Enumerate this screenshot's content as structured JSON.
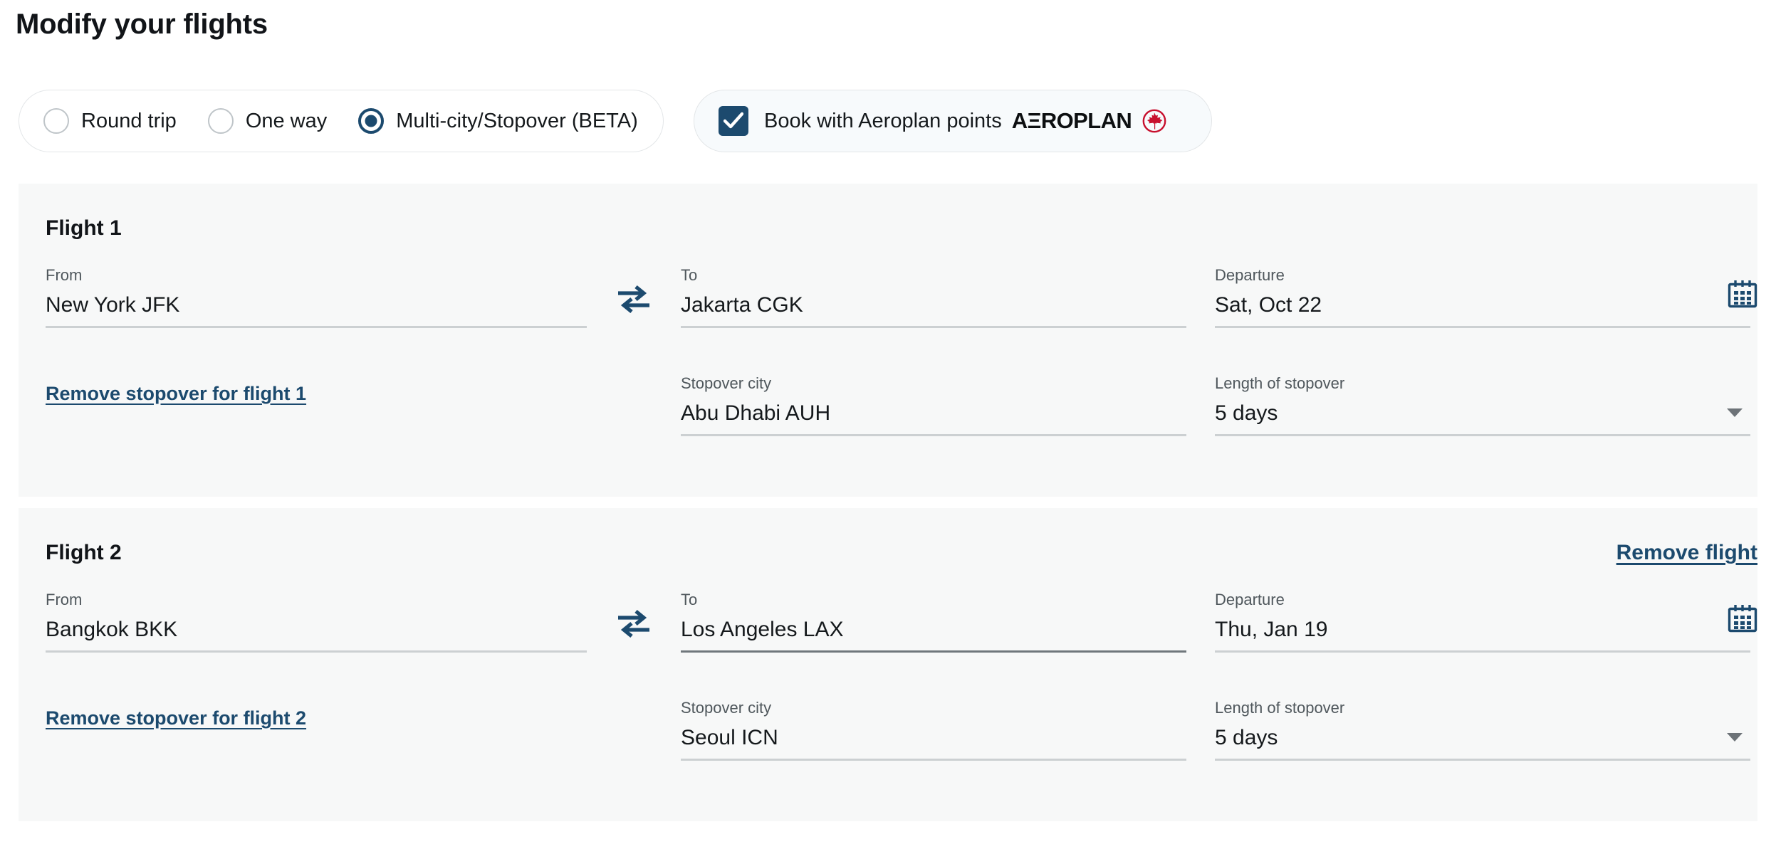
{
  "page_title": "Modify your flights",
  "trip_type": {
    "options": [
      {
        "label": "Round trip",
        "selected": false
      },
      {
        "label": "One way",
        "selected": false
      },
      {
        "label": "Multi-city/Stopover (BETA)",
        "selected": true
      }
    ]
  },
  "aeroplan": {
    "checked": true,
    "label": "Book with Aeroplan points",
    "logo_text": "AΞROPLAN",
    "logo_color": "#0d0f11",
    "roundel_color": "#c8102e",
    "checkbox_color": "#1c4a6e"
  },
  "colors": {
    "accent": "#1c4a6e",
    "panel_bg": "#f7f8f8",
    "rule": "#ccd0d2",
    "rule_focus": "#70777c",
    "label": "#4f575c"
  },
  "labels": {
    "from": "From",
    "to": "To",
    "departure": "Departure",
    "stopover_city": "Stopover city",
    "length_of_stopover": "Length of stopover"
  },
  "icons": {
    "swap": "swap-horizontal-icon",
    "calendar": "calendar-icon",
    "caret": "chevron-down-icon"
  },
  "flights": [
    {
      "title": "Flight 1",
      "from": "New York JFK",
      "to": "Jakarta CGK",
      "departure": "Sat, Oct 22",
      "stopover_city": "Abu Dhabi AUH",
      "stopover_length": "5 days",
      "remove_stopover_label": "Remove stopover for flight 1",
      "remove_flight_label": "",
      "has_remove_flight": false,
      "to_focused": false
    },
    {
      "title": "Flight 2",
      "from": "Bangkok BKK",
      "to": "Los Angeles LAX",
      "departure": "Thu, Jan 19",
      "stopover_city": "Seoul ICN",
      "stopover_length": "5 days",
      "remove_stopover_label": "Remove stopover for flight 2",
      "remove_flight_label": "Remove flight",
      "has_remove_flight": true,
      "to_focused": true
    }
  ]
}
